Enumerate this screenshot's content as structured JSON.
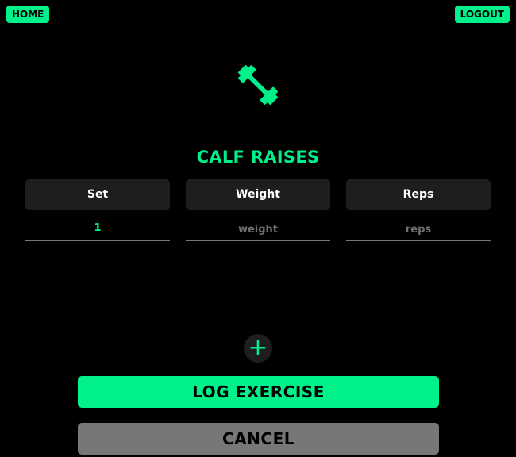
{
  "nav": {
    "home_label": "HOME",
    "logout_label": "LOGOUT"
  },
  "logo_icon": "dumbbell-icon",
  "exercise": {
    "title": "CALF RAISES"
  },
  "table": {
    "headers": [
      "Set",
      "Weight",
      "Reps"
    ],
    "rows": [
      {
        "set": "1",
        "weight_placeholder": "weight",
        "reps_placeholder": "reps"
      }
    ]
  },
  "add_set_label": "+",
  "actions": {
    "log_label": "LOG EXERCISE",
    "cancel_label": "CANCEL"
  },
  "colors": {
    "accent": "#00f08a",
    "background": "#000000",
    "panel": "#1e1e1e",
    "cancel": "#777777"
  }
}
